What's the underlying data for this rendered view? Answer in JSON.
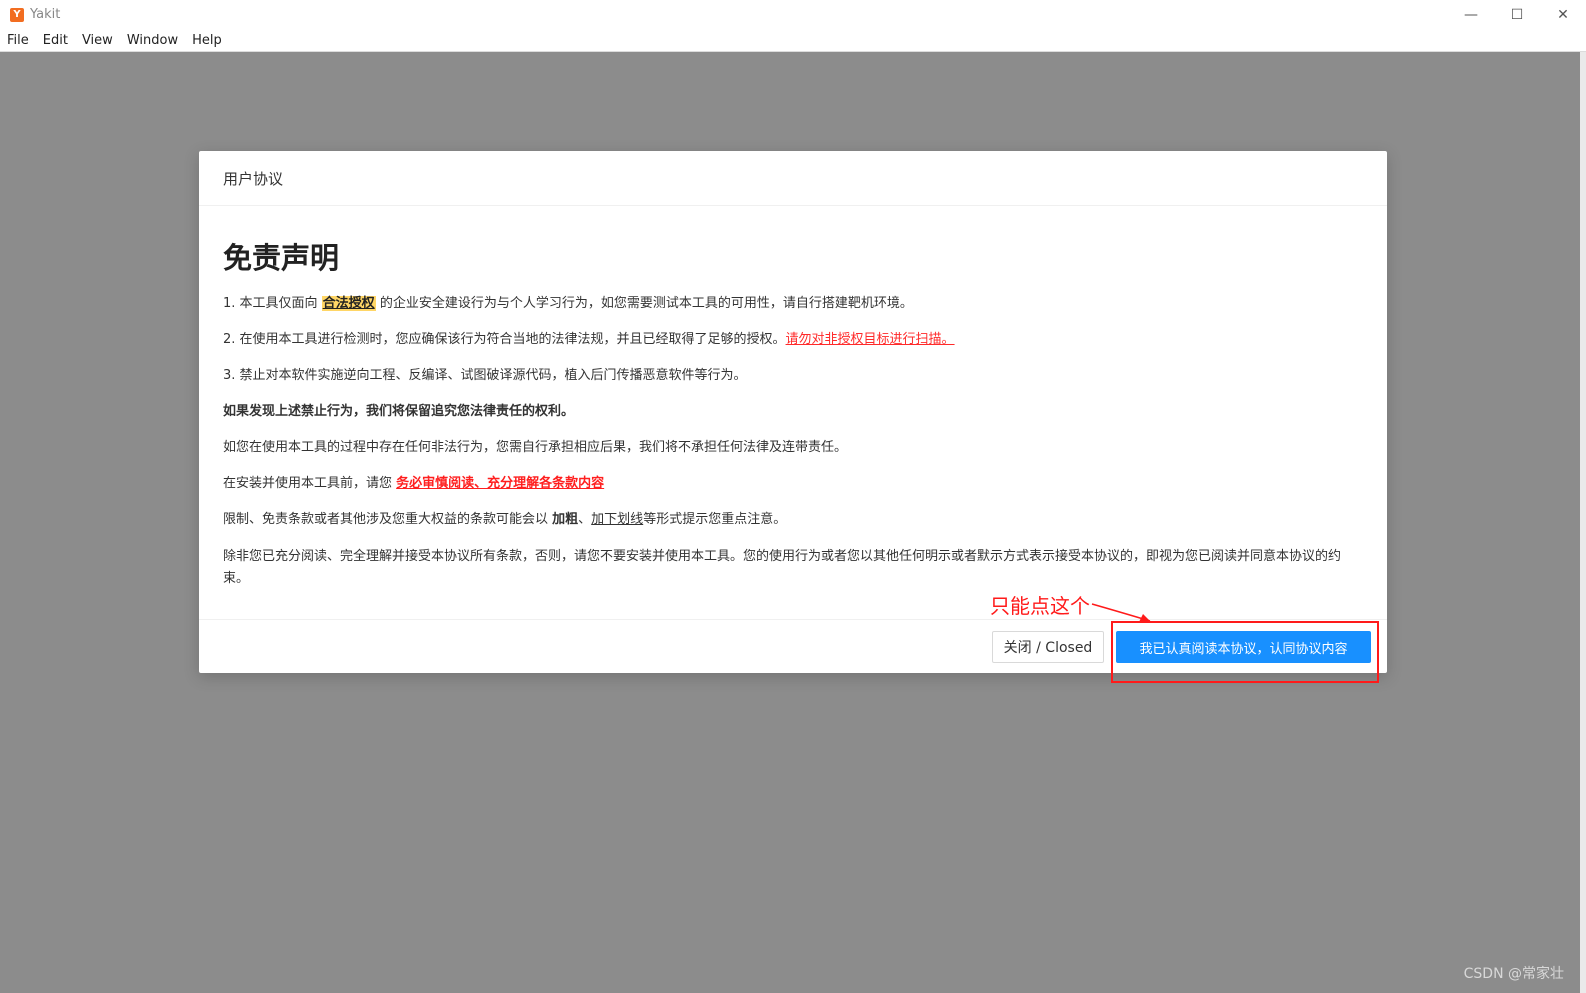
{
  "window": {
    "app_name": "Yakit",
    "logo_glyph": "Y",
    "controls": {
      "minimize": "—",
      "maximize": "☐",
      "close": "✕"
    }
  },
  "menu": [
    "File",
    "Edit",
    "View",
    "Window",
    "Help"
  ],
  "dialog": {
    "title": "用户协议",
    "heading": "免责声明",
    "p1": {
      "a": "1. 本工具仅面向 ",
      "highlight": "合法授权",
      "b": " 的企业安全建设行为与个人学习行为，如您需要测试本工具的可用性，请自行搭建靶机环境。"
    },
    "p2": {
      "a": "2. 在使用本工具进行检测时，您应确保该行为符合当地的法律法规，并且已经取得了足够的授权。",
      "link": "请勿对非授权目标进行扫描。"
    },
    "p3": "3. 禁止对本软件实施逆向工程、反编译、试图破译源代码，植入后门传播恶意软件等行为。",
    "p4": "如果发现上述禁止行为，我们将保留追究您法律责任的权利。",
    "p5": "如您在使用本工具的过程中存在任何非法行为，您需自行承担相应后果，我们将不承担任何法律及连带责任。",
    "p6": {
      "a": "在安装并使用本工具前，请您 ",
      "emph": "务必审慎阅读、充分理解各条款内容"
    },
    "p7": {
      "a": "限制、免责条款或者其他涉及您重大权益的条款可能会以 ",
      "bold": "加粗",
      "sep": "、",
      "underline": "加下划线",
      "b": "等形式提示您重点注意。"
    },
    "p8": "除非您已充分阅读、完全理解并接受本协议所有条款，否则，请您不要安装并使用本工具。您的使用行为或者您以其他任何明示或者默示方式表示接受本协议的，即视为您已阅读并同意本协议的约束。",
    "close_button": "关闭 / Closed",
    "agree_button": "我已认真阅读本协议，认同协议内容"
  },
  "annotation": {
    "text": "只能点这个",
    "color": "#ff1a1a"
  },
  "watermark": "CSDN @常家壮",
  "colors": {
    "primary": "#1890ff",
    "overlay": "#8c8c8c",
    "highlight": "#ffd666",
    "danger": "#ff1f1f"
  }
}
